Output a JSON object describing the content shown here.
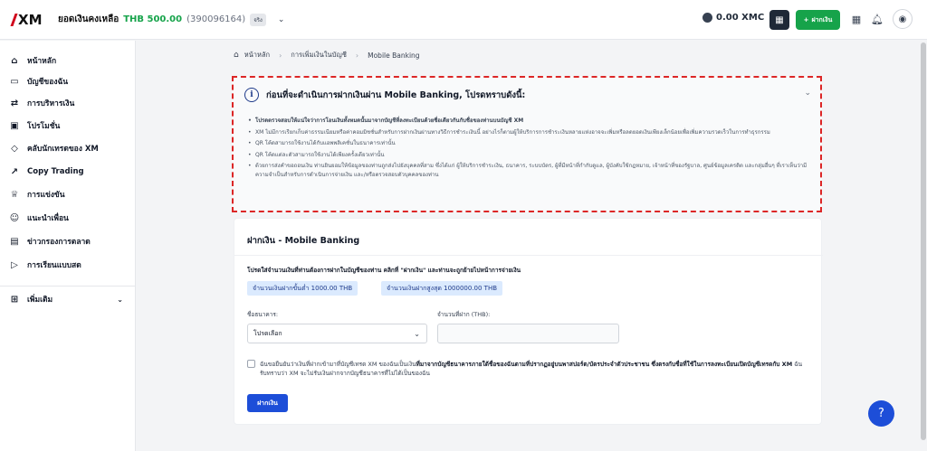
{
  "header": {
    "logo_text": "XM",
    "balance_label": "ยอดเงินคงเหลือ",
    "balance_amount": "THB 500.00",
    "account_number": "(390096164)",
    "account_tag": "จริง",
    "xmc_balance": "0.00 XMC",
    "deposit_label": "ฝากเงิน"
  },
  "sidebar": {
    "items": [
      {
        "label": "หน้าหลัก",
        "icon": "home-icon"
      },
      {
        "label": "บัญชีของฉัน",
        "icon": "wallet-icon"
      },
      {
        "label": "การบริหารเงิน",
        "icon": "transfer-icon"
      },
      {
        "label": "โปรโมชั่น",
        "icon": "gift-icon"
      },
      {
        "label": "คลับนักเทรดของ XM",
        "icon": "diamond-icon"
      },
      {
        "label": "Copy Trading",
        "icon": "trend-icon"
      },
      {
        "label": "การแข่งขัน",
        "icon": "trophy-icon"
      },
      {
        "label": "แนะนำเพื่อน",
        "icon": "users-icon"
      },
      {
        "label": "ข่าวกรองการตลาด",
        "icon": "calendar-icon"
      },
      {
        "label": "การเรียนแบบสด",
        "icon": "video-icon"
      }
    ],
    "more_label": "เพิ่มเติม"
  },
  "breadcrumb": {
    "home": "หน้าหลัก",
    "middle": "การเพิ่มเงินในบัญชี",
    "current": "Mobile Banking"
  },
  "notice": {
    "title": "ก่อนที่จะดำเนินการฝากเงินผ่าน Mobile Banking, โปรดทราบดังนี้:",
    "items": [
      "โปรดตรวจสอบให้แน่ใจว่าการโอนเงินทั้งหมดนั้นมาจากบัญชีที่ลงทะเบียนด้วยชื่อเดียวกันกับชื่อของท่านบนบัญชี XM",
      "XM ไม่มีการเรียกเก็บค่าธรรมเนียมหรือค่าคอมมิชชั่นสำหรับการฝากเงินผ่านทางวิธีการชำระเงินนี้ อย่างไรก็ตามผู้ให้บริการการชำระเงินหลายแห่งอาจจะเพิ่มหรือลดยอดเงินเพียงเล็กน้อยเพื่อเพิ่มความรวดเร็วในการทำธุรกรรม",
      "QR โค้ดสามารถใช้งานได้กับแอพพลิเคชั่นในธนาคารเท่านั้น",
      "QR โค้ดแต่ละตัวสามารถใช้งานได้เพียงครั้งเดียวเท่านั้น",
      "ด้วยการส่งคำขอถอนเงิน ท่านยินยอมให้ข้อมูลของท่านถูกส่งไปยังบุคคลที่สาม ซึ่งได้แก่ ผู้ให้บริการชำระเงิน, ธนาคาร, ระบบบัตร, ผู้ที่มีหน้าที่กำกับดูแล, ผู้บังคับใช้กฎหมาย, เจ้าหน้าที่ของรัฐบาล, ศูนย์ข้อมูลเครดิต และกลุ่มอื่นๆ ที่เราเห็นว่ามีความจำเป็นสำหรับการดำเนินการจ่ายเงิน และ/หรือตรวจสอบตัวบุคคลของท่าน"
    ]
  },
  "form": {
    "title": "ฝากเงิน - Mobile Banking",
    "instruction": "โปรดใส่จำนวนเงินที่ท่านต้องการฝากในบัญชีของท่าน คลิกที่ \"ฝากเงิน\" และท่านจะถูกย้ายไปหน้าการจ่ายเงิน",
    "min_chip": "จำนวนเงินฝากขั้นต่ำ 1000.00 THB",
    "max_chip": "จำนวนเงินฝากสูงสุด 1000000.00 THB",
    "bank_label": "ชื่อธนาคาร:",
    "bank_selected": "โปรดเลือก",
    "amount_label": "จำนวนที่ฝาก (THB):",
    "amount_value": "",
    "consent_text_1": "ฉันขอยืนยันว่าเงินที่ฝากเข้ามาที่บัญชีเทรด XM ของฉันเป็นเงิน",
    "consent_bold_1": "ที่มาจากบัญชีธนาคารภายใต้ชื่อของฉันตามที่ปรากฏอยู่บนพาสปอร์ต/บัตรประจำตัวประชาชน ซึ่งตรงกับชื่อที่ใช้ในการลงทะเบียนเปิดบัญชีเทรดกับ XM",
    "consent_text_2": " ฉันรับทราบว่า XM จะไม่รับเงินฝากจากบัญชีธนาคารที่ไม่ได้เป็นของฉัน",
    "submit_label": "ฝากเงิน"
  }
}
